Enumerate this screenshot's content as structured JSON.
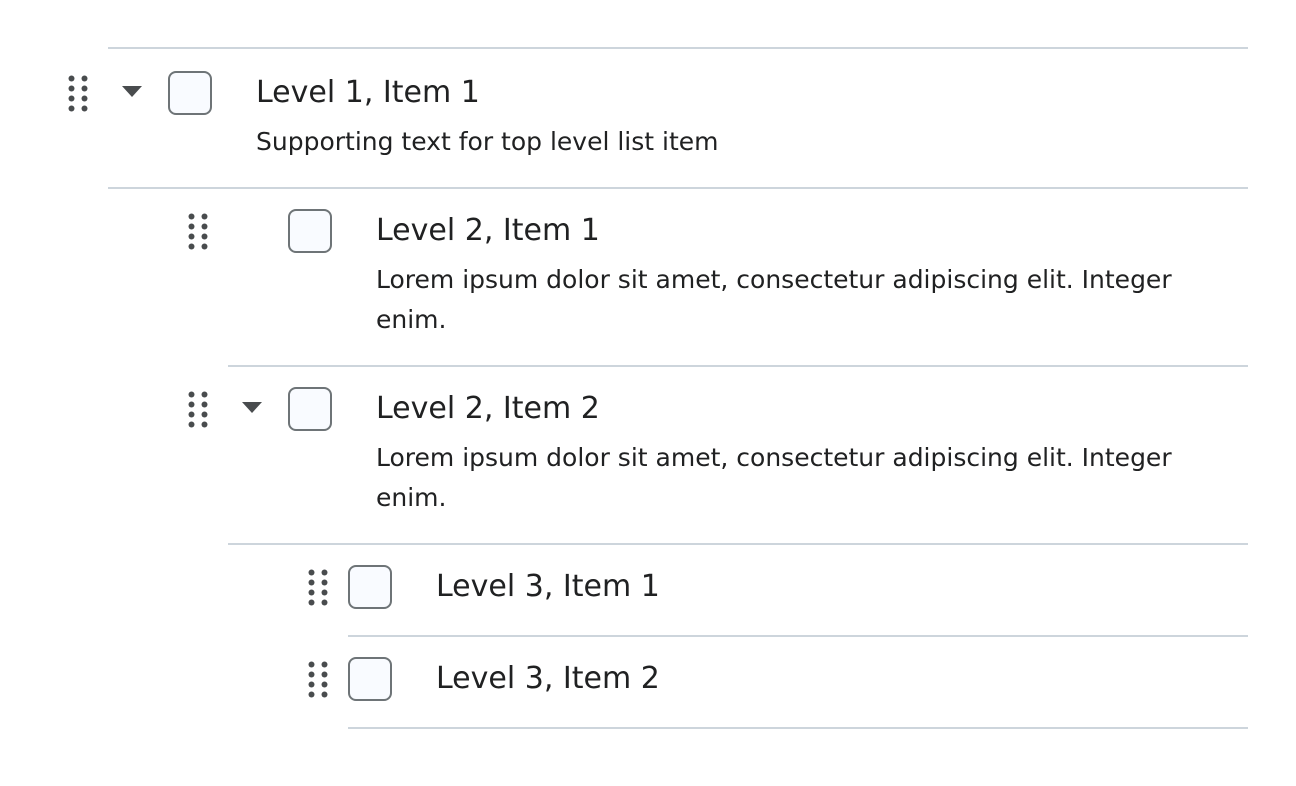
{
  "list": {
    "items": [
      {
        "title": "Level 1, Item 1",
        "description": "Supporting text for top level list item",
        "expanded": true
      },
      {
        "title": "Level 2, Item 1",
        "description": "Lorem ipsum dolor sit amet, consectetur adipiscing elit. Integer enim."
      },
      {
        "title": "Level 2, Item 2",
        "description": "Lorem ipsum dolor sit amet, consectetur adipiscing elit. Integer enim.",
        "expanded": true
      },
      {
        "title": "Level 3, Item 1"
      },
      {
        "title": "Level 3, Item 2"
      }
    ]
  },
  "icons": {
    "drag": "drag-handle-icon",
    "caret": "caret-down-icon"
  },
  "colors": {
    "divider": "#cdd5dc",
    "checkbox_border": "#6e7477",
    "checkbox_fill": "#f9fbff",
    "icon": "#494c4e",
    "text": "#202122"
  }
}
